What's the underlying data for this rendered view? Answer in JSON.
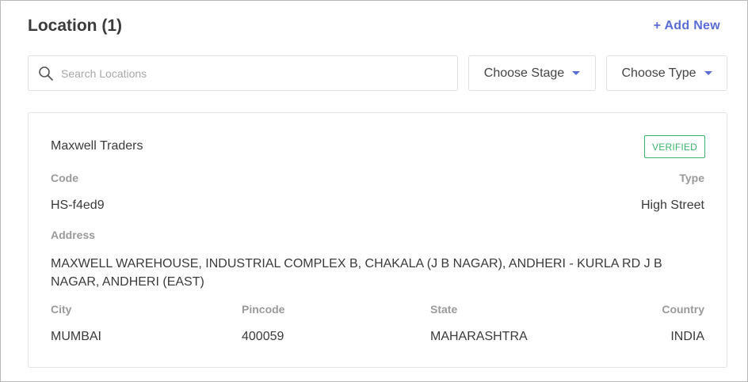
{
  "header": {
    "title": "Location (1)",
    "add_new_label": "+ Add New"
  },
  "filters": {
    "search_placeholder": "Search Locations",
    "search_value": "",
    "stage_label": "Choose Stage",
    "type_label": "Choose Type"
  },
  "location": {
    "name": "Maxwell Traders",
    "status": "VERIFIED",
    "code_label": "Code",
    "code": "HS-f4ed9",
    "type_label": "Type",
    "type": "High Street",
    "address_label": "Address",
    "address": "MAXWELL WAREHOUSE, INDUSTRIAL COMPLEX B, CHAKALA (J B NAGAR), ANDHERI - KURLA RD J B NAGAR, ANDHERI (EAST)",
    "city_label": "City",
    "city": "MUMBAI",
    "pincode_label": "Pincode",
    "pincode": "400059",
    "state_label": "State",
    "state": "MAHARASHTRA",
    "country_label": "Country",
    "country": "INDIA"
  },
  "colors": {
    "accent": "#5a6cd6",
    "verified": "#3bb56a",
    "label": "#9a9a9a"
  },
  "icons": {
    "search": "search-icon",
    "dropdown": "caret-down-icon"
  }
}
